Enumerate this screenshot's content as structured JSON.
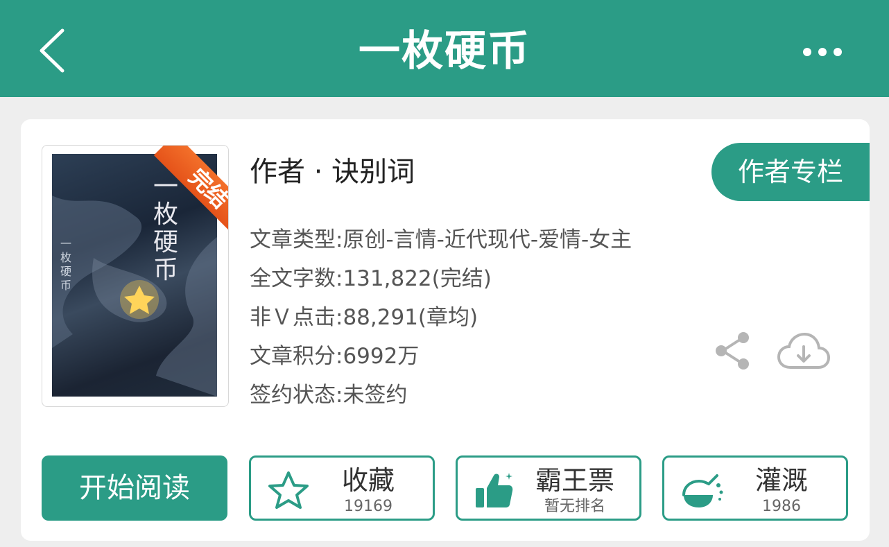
{
  "header": {
    "title": "一枚硬币",
    "back_icon": "chevron-left-icon",
    "more_icon": "more-dots-icon",
    "bg_color": "#2b9c86"
  },
  "book": {
    "cover": {
      "badge": "完结",
      "title_text": "一枚硬币",
      "vertical_text": "一枚硬币"
    },
    "author_line": "作者 · 诀别词",
    "author_column_button": "作者专栏",
    "info": [
      "文章类型:原创-言情-近代现代-爱情-女主",
      "全文字数:131,822(完结)",
      "非Ｖ点击:88,291(章均)",
      "文章积分:6992万",
      "签约状态:未签约"
    ],
    "share_icon": "share-icon",
    "download_icon": "cloud-download-icon"
  },
  "actions": {
    "start_reading": "开始阅读",
    "favorite": {
      "label": "收藏",
      "sub": "19169",
      "icon": "star-icon"
    },
    "vote": {
      "label": "霸王票",
      "sub": "暂无排名",
      "icon": "thumbs-up-icon"
    },
    "nutrient": {
      "label": "灌溉",
      "sub": "1986",
      "icon": "flask-icon"
    }
  },
  "colors": {
    "accent": "#2b9c86",
    "badge": "#e85d20",
    "icon_gray": "#b5b5b5"
  }
}
